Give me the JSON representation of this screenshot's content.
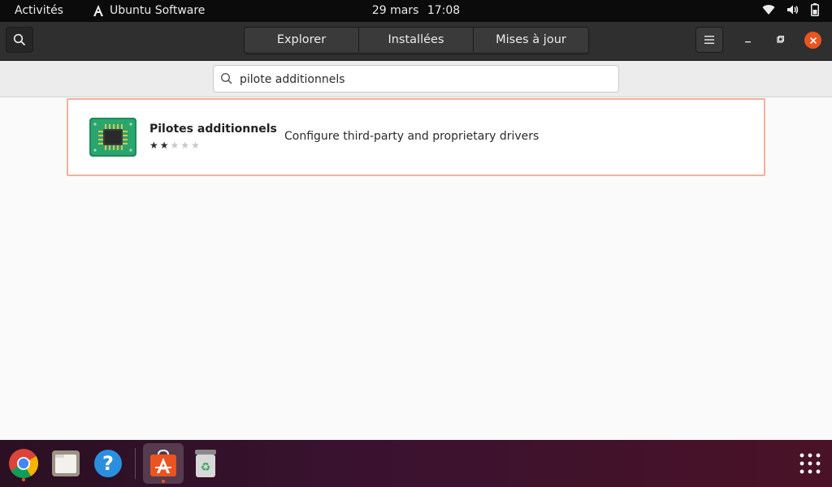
{
  "topbar": {
    "activities": "Activités",
    "app_name": "Ubuntu Software",
    "date": "29 mars",
    "time": "17:08",
    "icons": [
      "wifi-icon",
      "volume-icon",
      "battery-icon"
    ]
  },
  "headerbar": {
    "tabs": [
      {
        "label": "Explorer"
      },
      {
        "label": "Installées"
      },
      {
        "label": "Mises à jour"
      }
    ],
    "icons": [
      "search-icon",
      "hamburger-menu-icon",
      "minimize-icon",
      "maximize-icon",
      "close-icon"
    ]
  },
  "search": {
    "value": "pilote additionnels"
  },
  "results": [
    {
      "name": "Pilotes additionnels",
      "description": "Configure third-party and proprietary drivers",
      "rating_stars": 2,
      "max_stars": 5,
      "icon": "chip-icon"
    }
  ],
  "dock": {
    "items": [
      {
        "icon": "chrome-icon",
        "running": true
      },
      {
        "icon": "files-icon",
        "running": false
      },
      {
        "icon": "help-icon",
        "running": false
      },
      {
        "icon": "ubuntu-software-icon",
        "running": true,
        "active": true
      },
      {
        "icon": "trash-icon",
        "running": false
      }
    ],
    "apps_icon": "show-apps-grid-icon"
  },
  "colors": {
    "accent": "#e95420",
    "topbar_bg": "#0b0b0b",
    "headerbar_bg": "#2f2f2f",
    "card_border": "#f0b39c"
  }
}
